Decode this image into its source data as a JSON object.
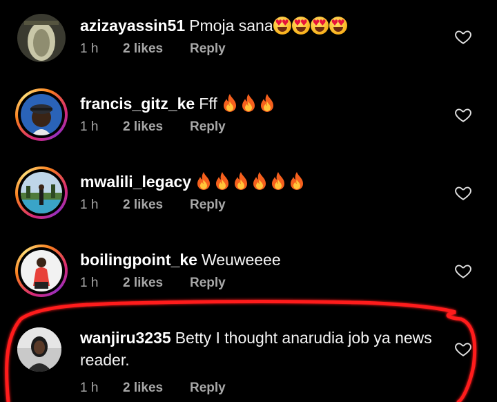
{
  "comments": [
    {
      "username": "azizayassin51",
      "text": "Pmoja sana",
      "emoji": "heart-eyes",
      "emoji_count": 4,
      "time": "1 h",
      "likes": "2 likes",
      "reply": "Reply"
    },
    {
      "username": "francis_gitz_ke",
      "text": "Fff",
      "emoji": "fire",
      "emoji_count": 3,
      "time": "1 h",
      "likes": "2 likes",
      "reply": "Reply"
    },
    {
      "username": "mwalili_legacy",
      "text": "",
      "emoji": "fire",
      "emoji_count": 6,
      "time": "1 h",
      "likes": "2 likes",
      "reply": "Reply"
    },
    {
      "username": "boilingpoint_ke",
      "text": "Weuweeee",
      "emoji": "",
      "emoji_count": 0,
      "time": "1 h",
      "likes": "2 likes",
      "reply": "Reply"
    },
    {
      "username": "wanjiru3235",
      "text": "Betty I thought anarudia job ya news reader.",
      "emoji": "",
      "emoji_count": 0,
      "time": "1 h",
      "likes": "2 likes",
      "reply": "Reply"
    }
  ],
  "colors": {
    "background": "#000000",
    "text": "#ffffff",
    "meta": "#a8a8a8",
    "highlight": "#ff1a1a"
  }
}
